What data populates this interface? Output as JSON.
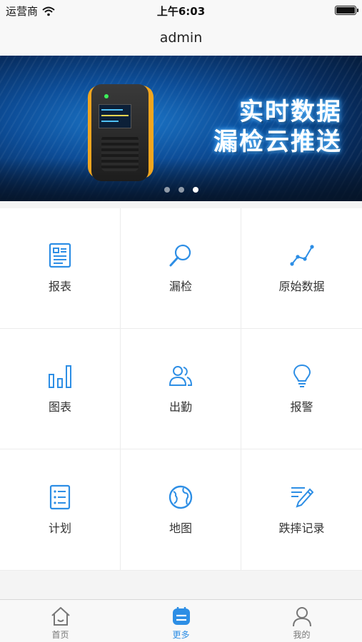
{
  "status_bar": {
    "carrier": "运营商",
    "time": "上午6:03"
  },
  "nav": {
    "title": "admin"
  },
  "banner": {
    "headline_line1": "实时数据",
    "headline_line2": "漏检云推送",
    "slide_count": 3,
    "active_slide": 3
  },
  "grid": {
    "items": [
      {
        "label": "报表",
        "icon": "report-icon"
      },
      {
        "label": "漏检",
        "icon": "magnifier-icon"
      },
      {
        "label": "原始数据",
        "icon": "line-graph-icon"
      },
      {
        "label": "图表",
        "icon": "bar-chart-icon"
      },
      {
        "label": "出勤",
        "icon": "people-icon"
      },
      {
        "label": "报警",
        "icon": "lightbulb-icon"
      },
      {
        "label": "计划",
        "icon": "list-icon"
      },
      {
        "label": "地图",
        "icon": "globe-icon"
      },
      {
        "label": "跌摔记录",
        "icon": "pen-note-icon"
      }
    ]
  },
  "tab_bar": {
    "items": [
      {
        "label": "首页",
        "icon": "home-icon",
        "active": false
      },
      {
        "label": "更多",
        "icon": "more-icon",
        "active": true
      },
      {
        "label": "我的",
        "icon": "user-icon",
        "active": false
      }
    ]
  },
  "colors": {
    "accent": "#2d8ee5",
    "label": "#333333",
    "tab_inactive": "#777777"
  }
}
